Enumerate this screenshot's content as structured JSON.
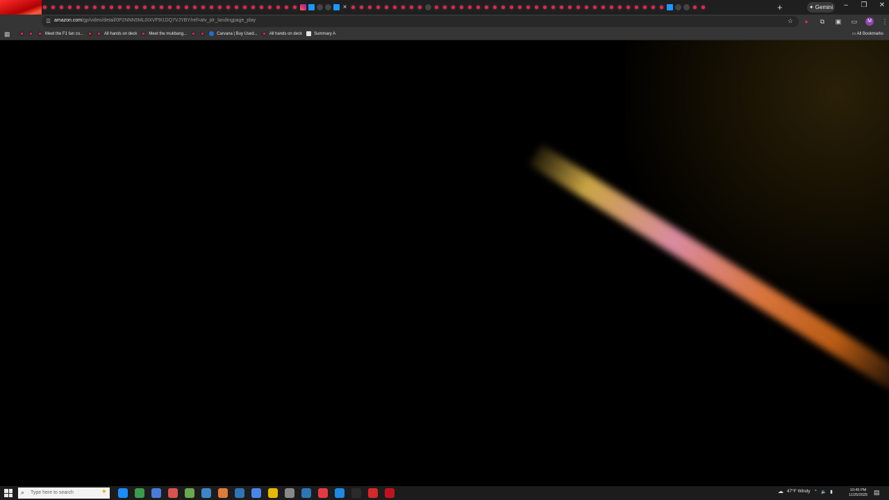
{
  "browser": {
    "tabs": {
      "new_tab_glyph": "+",
      "active_close_glyph": "×",
      "favicons": [
        "yt",
        "yt",
        "yt",
        "yt",
        "yt",
        "yt",
        "yt",
        "yt",
        "yt",
        "yt",
        "yt",
        "yt",
        "yt",
        "yt",
        "yt",
        "yt",
        "yt",
        "yt",
        "yt",
        "yt",
        "yt",
        "yt",
        "yt",
        "yt",
        "yt",
        "yt",
        "yt",
        "yt",
        "yt",
        "yt",
        "yt",
        "ig",
        "pv",
        "gr",
        "gr",
        "pv",
        "active-close",
        "yt",
        "yt",
        "yt",
        "yt",
        "yt",
        "yt",
        "yt",
        "yt",
        "yt",
        "gr",
        "yt",
        "yt",
        "yt",
        "yt",
        "yt",
        "yt",
        "yt",
        "yt",
        "yt",
        "yt",
        "yt",
        "yt",
        "yt",
        "yt",
        "yt",
        "yt",
        "yt",
        "yt",
        "yt",
        "yt",
        "yt",
        "yt",
        "yt",
        "yt",
        "yt",
        "yt",
        "yt",
        "yt",
        "pv",
        "gr",
        "gr",
        "yt",
        "yt"
      ]
    },
    "gemini_label": "✦ Gemini",
    "window_controls": [
      "–",
      "❐",
      "✕"
    ],
    "url_domain": "amazon.com",
    "url_path": "/gp/video/detail/0P2NNN5ML0IXVF9I1DQ7VJYBY/ref=atv_plr_landingpage_play",
    "avatar_letter": "M",
    "bookmarks": [
      {
        "icon": "yt",
        "label": ""
      },
      {
        "icon": "yt",
        "label": ""
      },
      {
        "icon": "yt",
        "label": "Meet the F1 fan co..."
      },
      {
        "icon": "yt",
        "label": ""
      },
      {
        "icon": "yt",
        "label": "All hands on deck"
      },
      {
        "icon": "yt",
        "label": "Meet the mukbang..."
      },
      {
        "icon": "yt",
        "label": ""
      },
      {
        "icon": "yt",
        "label": ""
      },
      {
        "icon": "cv",
        "label": "Carvana | Buy Used..."
      },
      {
        "icon": "yt",
        "label": "All hands on deck"
      },
      {
        "icon": "sm",
        "label": "Summary A"
      }
    ],
    "all_bookmarks_label": "All Bookmarks"
  },
  "taskbar": {
    "search_placeholder": "Type here to search",
    "app_colors": [
      "#1a8cff",
      "#3a9b4b",
      "#4a7bd8",
      "#d9534f",
      "#6aa84f",
      "#3d85c6",
      "#e07b39",
      "#2e75b6",
      "#4a86e8",
      "#e6b800",
      "#888888",
      "#2e75b6",
      "#e63946",
      "#1e88e5",
      "#2b2b2b",
      "#d62828",
      "#c1121f"
    ],
    "weather": "47°F  Windy",
    "time": "10:45 PM",
    "date": "11/25/2025"
  }
}
